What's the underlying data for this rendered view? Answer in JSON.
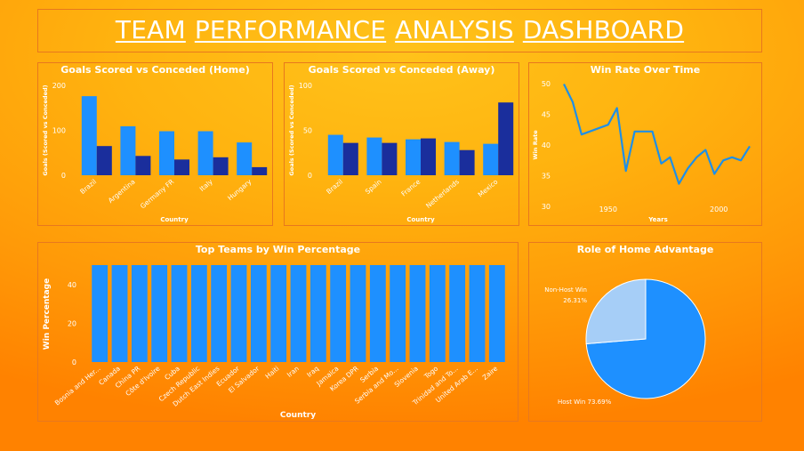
{
  "dashboard": {
    "title_words": [
      "TEAM",
      "PERFORMANCE",
      "ANALYSIS",
      "DASHBOARD"
    ]
  },
  "colors": {
    "light_bar": "#1e90ff",
    "dark_bar": "#1a2e9c",
    "line": "#1e8fe8",
    "pie_host": "#1e90ff",
    "pie_nonhost": "#a6cef7"
  },
  "chart_data": [
    {
      "id": "home",
      "type": "bar",
      "title": "Goals Scored vs Conceded (Home)",
      "xlabel": "Country",
      "ylabel": "Goals (Scored vs Conceded)",
      "categories": [
        "Brazil",
        "Argentina",
        "Germany FR",
        "Italy",
        "Hungary"
      ],
      "series": [
        {
          "values": [
            176,
            109,
            98,
            98,
            73
          ]
        },
        {
          "values": [
            65,
            43,
            35,
            40,
            18
          ]
        }
      ],
      "ylim": [
        0,
        200
      ],
      "yticks": [
        0,
        100,
        200
      ]
    },
    {
      "id": "away",
      "type": "bar",
      "title": "Goals Scored vs Conceded (Away)",
      "xlabel": "Country",
      "ylabel": "Goals (Scored vs Conceded)",
      "categories": [
        "Brazil",
        "Spain",
        "France",
        "Netherlands",
        "Mexico"
      ],
      "series": [
        {
          "values": [
            45,
            42,
            40,
            37,
            35
          ]
        },
        {
          "values": [
            36,
            36,
            41,
            28,
            81
          ]
        }
      ],
      "ylim": [
        0,
        100
      ],
      "yticks": [
        0,
        50,
        100
      ]
    },
    {
      "id": "winrate",
      "type": "line",
      "title": "Win Rate Over Time",
      "xlabel": "Years",
      "ylabel": "Win Rate",
      "x": [
        1930,
        1934,
        1938,
        1950,
        1954,
        1958,
        1962,
        1966,
        1970,
        1974,
        1978,
        1982,
        1986,
        1990,
        1994,
        1998,
        2002,
        2006,
        2010,
        2014
      ],
      "y": [
        49.9,
        47.0,
        41.7,
        43.3,
        46.0,
        35.8,
        42.2,
        42.2,
        42.2,
        37.0,
        38.0,
        33.7,
        36.2,
        38.0,
        39.2,
        35.3,
        37.5,
        38.0,
        37.5,
        39.8
      ],
      "xlim": [
        1928,
        2018
      ],
      "ylim": [
        28,
        52
      ],
      "xticks": [
        1950,
        2000
      ],
      "yticks": [
        30,
        35,
        40,
        45,
        50
      ]
    },
    {
      "id": "topteams",
      "type": "bar",
      "title": "Top Teams by Win Percentage",
      "xlabel": "Country",
      "ylabel": "Win Percentage",
      "categories": [
        "Bosnia and Her...",
        "Canada",
        "China PR",
        "Côte d'Ivoire",
        "Cuba",
        "Czech Republic",
        "Dutch East Indies",
        "Ecuador",
        "El Salvador",
        "Haiti",
        "Iran",
        "Iraq",
        "Jamaica",
        "Korea DPR",
        "Serbia",
        "Serbia and Mo...",
        "Slovenia",
        "Togo",
        "Trinidad and To...",
        "United Arab E...",
        "Zaire"
      ],
      "values": [
        50,
        50,
        50,
        50,
        50,
        50,
        50,
        50,
        50,
        50,
        50,
        50,
        50,
        50,
        50,
        50,
        50,
        50,
        50,
        50,
        50
      ],
      "ylim": [
        0,
        50
      ],
      "yticks": [
        0,
        20,
        40
      ]
    },
    {
      "id": "homeadv",
      "type": "pie",
      "title": "Role of Home Advantage",
      "slices": [
        {
          "label": "Host Win",
          "pct_label": "73.69%",
          "value": 73.69
        },
        {
          "label": "Non-Host Win",
          "pct_label": "26.31%",
          "value": 26.31
        }
      ]
    }
  ]
}
